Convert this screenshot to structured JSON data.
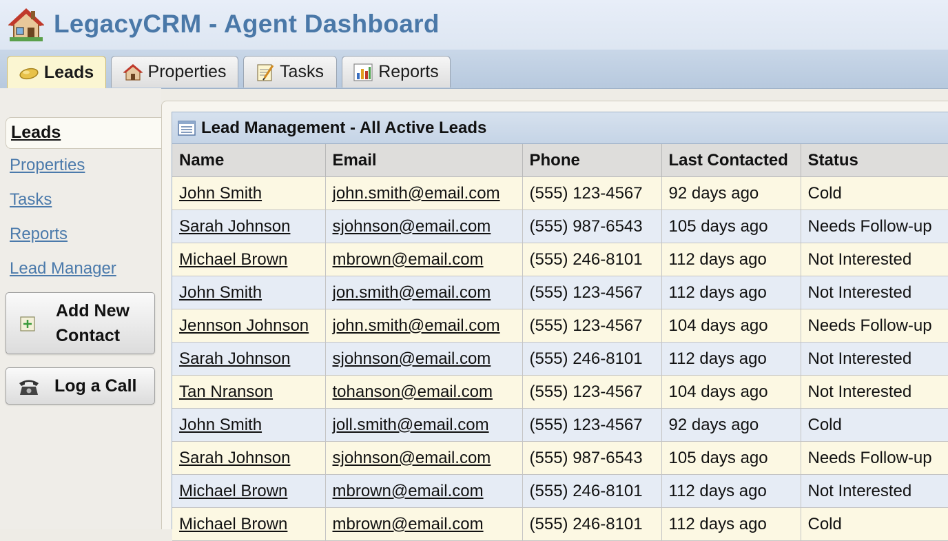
{
  "header": {
    "title": "LegacyCRM - Agent Dashboard",
    "logo_icon": "house-icon"
  },
  "tabs": [
    {
      "label": "Leads",
      "icon": "leads-icon",
      "active": true
    },
    {
      "label": "Properties",
      "icon": "house-icon",
      "active": false
    },
    {
      "label": "Tasks",
      "icon": "notepad-icon",
      "active": false
    },
    {
      "label": "Reports",
      "icon": "bar-chart-icon",
      "active": false
    }
  ],
  "sidebar": {
    "items": [
      {
        "label": "Leads",
        "active": true
      },
      {
        "label": "Properties"
      },
      {
        "label": "Tasks"
      },
      {
        "label": "Reports"
      },
      {
        "label": "Lead Manager"
      }
    ],
    "add_contact_line1": "Add New",
    "add_contact_line2": "Contact",
    "log_call_label": "Log a Call"
  },
  "panel": {
    "title": "Lead Management - All Active Leads",
    "columns": [
      "Name",
      "Email",
      "Phone",
      "Last Contacted",
      "Status"
    ],
    "rows": [
      [
        "John Smith",
        "john.smith@email.com",
        "(555) 123-4567",
        "92 days ago",
        "Cold"
      ],
      [
        "Sarah Johnson",
        "sjohnson@email.com",
        "(555) 987-6543",
        "105 days ago",
        "Needs Follow-up"
      ],
      [
        "Michael Brown",
        "mbrown@email.com",
        "(555) 246-8101",
        "112 days ago",
        "Not Interested"
      ],
      [
        "John Smith",
        "jon.smith@email.com",
        "(555) 123-4567",
        "112 days ago",
        "Not Interested"
      ],
      [
        "Jennson Johnson",
        "john.smith@email.com",
        "(555) 123-4567",
        "104 days ago",
        "Needs Follow-up"
      ],
      [
        "Sarah Johnson",
        "sjohnson@email.com",
        "(555) 246-8101",
        "112 days ago",
        "Not Interested"
      ],
      [
        "Tan Nranson",
        "tohanson@email.com",
        "(555) 123-4567",
        "104 days ago",
        "Not Interested"
      ],
      [
        "John Smith",
        "joll.smith@email.com",
        "(555) 123-4567",
        "92 days ago",
        "Cold"
      ],
      [
        "Sarah Johnson",
        "sjohnson@email.com",
        "(555) 987-6543",
        "105 days ago",
        "Needs Follow-up"
      ],
      [
        "Michael Brown",
        "mbrown@email.com",
        "(555) 246-8101",
        "112 days ago",
        "Not Interested"
      ],
      [
        "Michael Brown",
        "mbrown@email.com",
        "(555) 246-8101",
        "112 days ago",
        "Cold"
      ]
    ]
  },
  "colors": {
    "title_blue": "#4a78a8",
    "link_blue": "#4b7aab",
    "row_odd": "#fcf8e3",
    "row_even": "#e6ecf5",
    "active_tab": "#fbf6d2"
  }
}
